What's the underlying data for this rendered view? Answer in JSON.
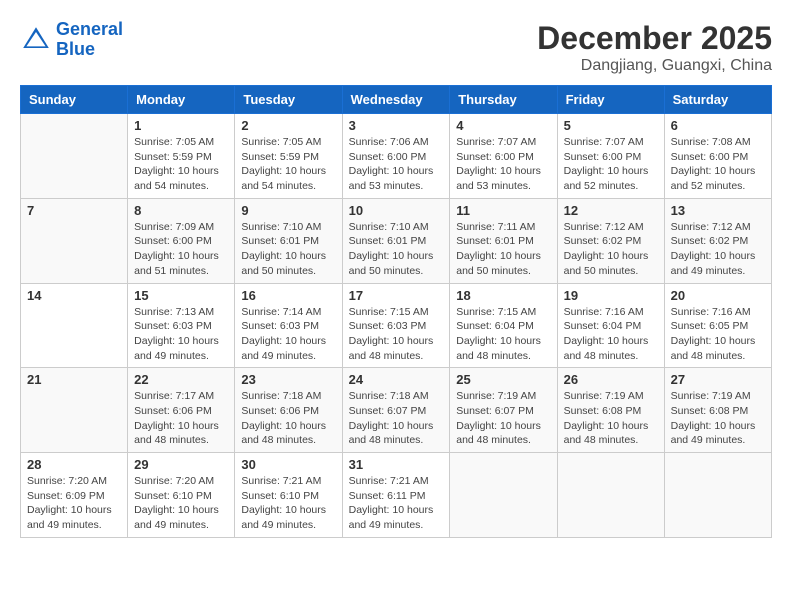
{
  "header": {
    "logo_line1": "General",
    "logo_line2": "Blue",
    "month_title": "December 2025",
    "location": "Dangjiang, Guangxi, China"
  },
  "weekdays": [
    "Sunday",
    "Monday",
    "Tuesday",
    "Wednesday",
    "Thursday",
    "Friday",
    "Saturday"
  ],
  "weeks": [
    [
      {
        "day": "",
        "info": ""
      },
      {
        "day": "1",
        "info": "Sunrise: 7:05 AM\nSunset: 5:59 PM\nDaylight: 10 hours\nand 54 minutes."
      },
      {
        "day": "2",
        "info": "Sunrise: 7:05 AM\nSunset: 5:59 PM\nDaylight: 10 hours\nand 54 minutes."
      },
      {
        "day": "3",
        "info": "Sunrise: 7:06 AM\nSunset: 6:00 PM\nDaylight: 10 hours\nand 53 minutes."
      },
      {
        "day": "4",
        "info": "Sunrise: 7:07 AM\nSunset: 6:00 PM\nDaylight: 10 hours\nand 53 minutes."
      },
      {
        "day": "5",
        "info": "Sunrise: 7:07 AM\nSunset: 6:00 PM\nDaylight: 10 hours\nand 52 minutes."
      },
      {
        "day": "6",
        "info": "Sunrise: 7:08 AM\nSunset: 6:00 PM\nDaylight: 10 hours\nand 52 minutes."
      }
    ],
    [
      {
        "day": "7",
        "info": ""
      },
      {
        "day": "8",
        "info": "Sunrise: 7:09 AM\nSunset: 6:00 PM\nDaylight: 10 hours\nand 51 minutes."
      },
      {
        "day": "9",
        "info": "Sunrise: 7:10 AM\nSunset: 6:01 PM\nDaylight: 10 hours\nand 50 minutes."
      },
      {
        "day": "10",
        "info": "Sunrise: 7:10 AM\nSunset: 6:01 PM\nDaylight: 10 hours\nand 50 minutes."
      },
      {
        "day": "11",
        "info": "Sunrise: 7:11 AM\nSunset: 6:01 PM\nDaylight: 10 hours\nand 50 minutes."
      },
      {
        "day": "12",
        "info": "Sunrise: 7:12 AM\nSunset: 6:02 PM\nDaylight: 10 hours\nand 50 minutes."
      },
      {
        "day": "13",
        "info": "Sunrise: 7:12 AM\nSunset: 6:02 PM\nDaylight: 10 hours\nand 49 minutes."
      }
    ],
    [
      {
        "day": "14",
        "info": ""
      },
      {
        "day": "15",
        "info": "Sunrise: 7:13 AM\nSunset: 6:03 PM\nDaylight: 10 hours\nand 49 minutes."
      },
      {
        "day": "16",
        "info": "Sunrise: 7:14 AM\nSunset: 6:03 PM\nDaylight: 10 hours\nand 49 minutes."
      },
      {
        "day": "17",
        "info": "Sunrise: 7:15 AM\nSunset: 6:03 PM\nDaylight: 10 hours\nand 48 minutes."
      },
      {
        "day": "18",
        "info": "Sunrise: 7:15 AM\nSunset: 6:04 PM\nDaylight: 10 hours\nand 48 minutes."
      },
      {
        "day": "19",
        "info": "Sunrise: 7:16 AM\nSunset: 6:04 PM\nDaylight: 10 hours\nand 48 minutes."
      },
      {
        "day": "20",
        "info": "Sunrise: 7:16 AM\nSunset: 6:05 PM\nDaylight: 10 hours\nand 48 minutes."
      }
    ],
    [
      {
        "day": "21",
        "info": ""
      },
      {
        "day": "22",
        "info": "Sunrise: 7:17 AM\nSunset: 6:06 PM\nDaylight: 10 hours\nand 48 minutes."
      },
      {
        "day": "23",
        "info": "Sunrise: 7:18 AM\nSunset: 6:06 PM\nDaylight: 10 hours\nand 48 minutes."
      },
      {
        "day": "24",
        "info": "Sunrise: 7:18 AM\nSunset: 6:07 PM\nDaylight: 10 hours\nand 48 minutes."
      },
      {
        "day": "25",
        "info": "Sunrise: 7:19 AM\nSunset: 6:07 PM\nDaylight: 10 hours\nand 48 minutes."
      },
      {
        "day": "26",
        "info": "Sunrise: 7:19 AM\nSunset: 6:08 PM\nDaylight: 10 hours\nand 48 minutes."
      },
      {
        "day": "27",
        "info": "Sunrise: 7:19 AM\nSunset: 6:08 PM\nDaylight: 10 hours\nand 49 minutes."
      }
    ],
    [
      {
        "day": "28",
        "info": "Sunrise: 7:20 AM\nSunset: 6:09 PM\nDaylight: 10 hours\nand 49 minutes."
      },
      {
        "day": "29",
        "info": "Sunrise: 7:20 AM\nSunset: 6:10 PM\nDaylight: 10 hours\nand 49 minutes."
      },
      {
        "day": "30",
        "info": "Sunrise: 7:21 AM\nSunset: 6:10 PM\nDaylight: 10 hours\nand 49 minutes."
      },
      {
        "day": "31",
        "info": "Sunrise: 7:21 AM\nSunset: 6:11 PM\nDaylight: 10 hours\nand 49 minutes."
      },
      {
        "day": "",
        "info": ""
      },
      {
        "day": "",
        "info": ""
      },
      {
        "day": "",
        "info": ""
      }
    ]
  ]
}
